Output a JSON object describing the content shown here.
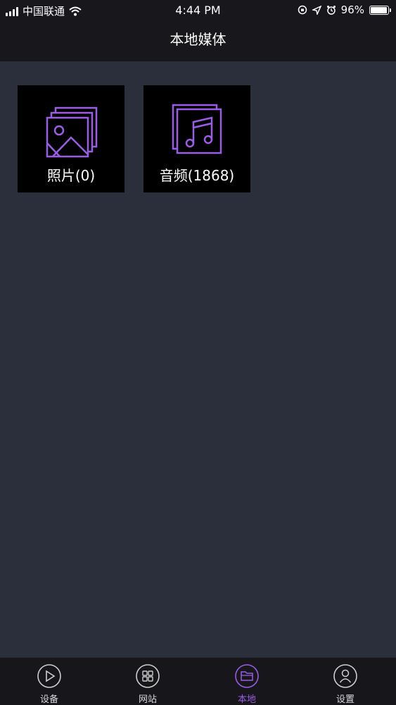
{
  "status_bar": {
    "carrier": "中国联通",
    "time": "4:44 PM",
    "battery_percent": "96%",
    "battery_level": 0.96,
    "icons": [
      "signal-icon",
      "wifi-icon",
      "orientation-lock-icon",
      "location-icon",
      "alarm-icon",
      "battery-icon"
    ]
  },
  "header": {
    "title": "本地媒体"
  },
  "tiles": [
    {
      "label": "照片(0)",
      "icon": "photo-stack-icon"
    },
    {
      "label": "音频(1868)",
      "icon": "music-stack-icon"
    }
  ],
  "tabbar": {
    "active_color": "#9b5de5",
    "tabs": [
      {
        "label": "设备",
        "icon": "play-icon",
        "active": false
      },
      {
        "label": "网站",
        "icon": "grid-icon",
        "active": false
      },
      {
        "label": "本地",
        "icon": "folder-icon",
        "active": true
      },
      {
        "label": "设置",
        "icon": "user-icon",
        "active": false
      }
    ]
  }
}
